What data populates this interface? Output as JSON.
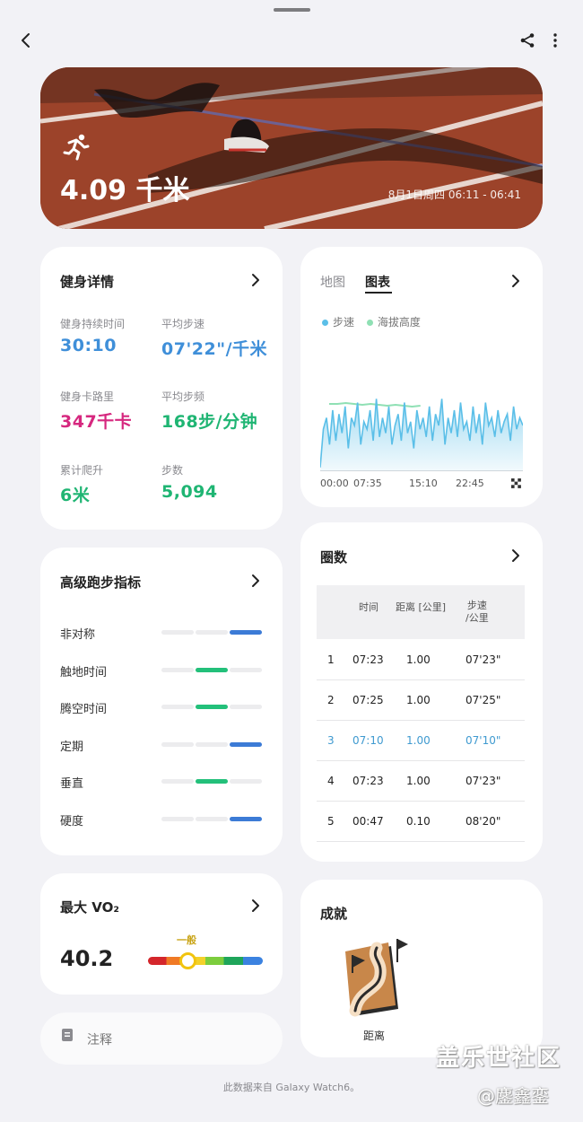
{
  "hero": {
    "distance": "4.09 千米",
    "time_range": "8月1日周四 06:11 - 06:41"
  },
  "fitness": {
    "title": "健身详情",
    "items": [
      {
        "label": "健身持续时间",
        "value": "30:10",
        "color": "#3f8fd9"
      },
      {
        "label": "平均步速",
        "value": "07'22\"/千米",
        "color": "#3f8fd9"
      },
      {
        "label": "健身卡路里",
        "value": "347千卡",
        "color": "#d6287f"
      },
      {
        "label": "平均步频",
        "value": "168步/分钟",
        "color": "#1fb573"
      },
      {
        "label": "累计爬升",
        "value": "6米",
        "color": "#1fb573"
      },
      {
        "label": "步数",
        "value": "5,094",
        "color": "#1fb573"
      }
    ]
  },
  "chart": {
    "tabs": [
      "地图",
      "图表"
    ],
    "active_tab": "图表",
    "legend": [
      "步速",
      "海拔高度"
    ],
    "ticks": [
      "00:00",
      "07:35",
      "15:10",
      "22:45"
    ]
  },
  "chart_data": {
    "type": "area",
    "x_ticks": [
      "00:00",
      "07:35",
      "15:10",
      "22:45"
    ],
    "series": [
      {
        "name": "步速",
        "color": "#5bbfe8",
        "values": [
          0.05,
          0.55,
          0.7,
          0.35,
          0.8,
          0.4,
          0.75,
          0.5,
          0.85,
          0.3,
          0.7,
          0.6,
          0.9,
          0.35,
          0.65,
          0.55,
          0.8,
          0.4,
          0.95,
          0.45,
          0.7,
          0.5,
          0.85,
          0.35,
          0.6,
          0.75,
          0.4,
          0.9,
          0.5,
          0.65,
          0.3,
          0.8,
          0.55,
          0.7,
          0.45,
          0.85,
          0.4,
          0.75,
          0.6,
          0.95,
          0.35,
          0.7,
          0.5,
          0.8,
          0.45,
          0.9,
          0.55,
          0.65,
          0.4,
          0.85,
          0.5,
          0.75,
          0.35,
          0.9,
          0.6,
          0.7,
          0.45,
          0.8,
          0.5,
          0.65,
          0.75,
          0.4,
          0.85,
          0.55,
          0.7,
          0.6
        ]
      },
      {
        "name": "海拔高度",
        "color": "#8fe0b4",
        "values": [
          0.75,
          0.75,
          0.76,
          0.75,
          0.74,
          0.75,
          0.74,
          0.73,
          0.74,
          0.73,
          0.72,
          0.73
        ]
      }
    ]
  },
  "advanced": {
    "title": "高级跑步指标",
    "metrics": [
      {
        "name": "非对称",
        "level": 3,
        "color": "#3c7bd6"
      },
      {
        "name": "触地时间",
        "level": 2,
        "color": "#23c07a"
      },
      {
        "name": "腾空时间",
        "level": 2,
        "color": "#23c07a"
      },
      {
        "name": "定期",
        "level": 3,
        "color": "#3c7bd6"
      },
      {
        "name": "垂直",
        "level": 2,
        "color": "#23c07a"
      },
      {
        "name": "硬度",
        "level": 3,
        "color": "#3c7bd6"
      }
    ]
  },
  "laps": {
    "title": "圈数",
    "headers": [
      "时间",
      "距离 [公里]",
      "步速\n/公里"
    ],
    "rows": [
      {
        "n": "1",
        "time": "07:23",
        "dist": "1.00",
        "pace": "07'23\"",
        "highlight": false
      },
      {
        "n": "2",
        "time": "07:25",
        "dist": "1.00",
        "pace": "07'25\"",
        "highlight": false
      },
      {
        "n": "3",
        "time": "07:10",
        "dist": "1.00",
        "pace": "07'10\"",
        "highlight": true
      },
      {
        "n": "4",
        "time": "07:23",
        "dist": "1.00",
        "pace": "07'23\"",
        "highlight": false
      },
      {
        "n": "5",
        "time": "00:47",
        "dist": "0.10",
        "pace": "08'20\"",
        "highlight": false
      }
    ]
  },
  "vo2": {
    "title": "最大 VO₂",
    "value": "40.2",
    "level_label": "一般",
    "level_fraction": 0.34
  },
  "achievement": {
    "title": "成就",
    "badge_label": "距离"
  },
  "note": {
    "label": "注释"
  },
  "footer": "此数据来自 Galaxy Watch6。",
  "watermark": {
    "line1": "盖乐世社区",
    "line2": "@鏖鑫銮"
  }
}
